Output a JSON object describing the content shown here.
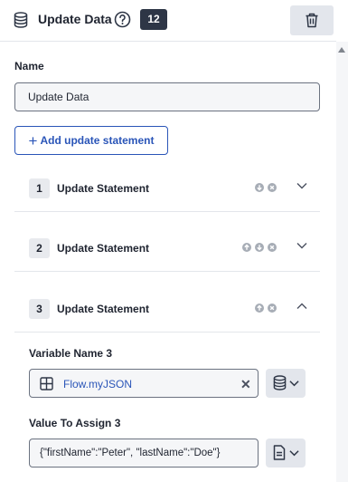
{
  "header": {
    "title": "Update Data",
    "badge": "12",
    "icons": {
      "component": "database-icon",
      "help": "help-circle-icon",
      "delete": "trash-icon"
    }
  },
  "name_section": {
    "label": "Name",
    "value": "Update Data"
  },
  "add_button": {
    "label": "Add update statement",
    "icon": "plus-icon"
  },
  "statements": [
    {
      "number": "1",
      "title": "Update Statement",
      "controls": [
        "move-down",
        "remove"
      ],
      "expanded": false
    },
    {
      "number": "2",
      "title": "Update Statement",
      "controls": [
        "move-up",
        "move-down",
        "remove"
      ],
      "expanded": false
    },
    {
      "number": "3",
      "title": "Update Statement",
      "controls": [
        "move-up",
        "remove"
      ],
      "expanded": true
    }
  ],
  "statement3": {
    "variable_label": "Variable Name 3",
    "variable_value": "Flow.myJSON",
    "value_label": "Value To Assign 3",
    "value_value": "{\"firstName\":\"Peter\", \"lastName\":\"Doe\"}"
  },
  "colors": {
    "accent": "#2a55b8",
    "badge_bg": "#2e3646",
    "button_bg": "#e3e6ec",
    "field_bg": "#f5f6f8"
  }
}
